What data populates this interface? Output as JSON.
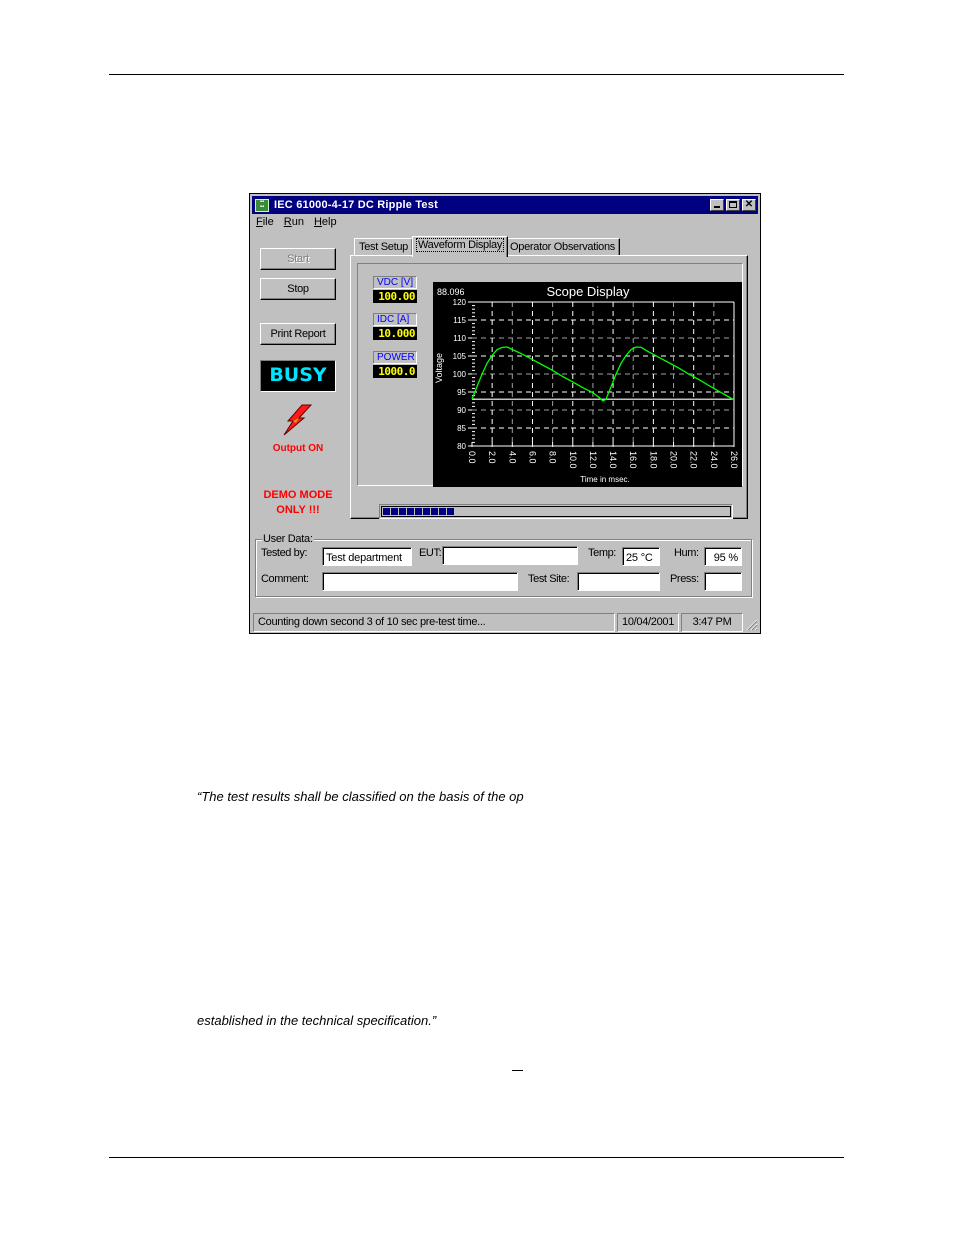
{
  "document": {
    "quote_line_1": "“The test results shall be classified on the basis of the op",
    "quote_line_2": "established in the technical specification.”"
  },
  "window": {
    "title": "IEC 61000-4-17 DC Ripple Test",
    "app_icon": "app-icon",
    "controls": {
      "minimize": "_",
      "maximize": "□",
      "close": "×"
    },
    "menu": [
      {
        "label": "File",
        "accel": "F",
        "rest": "ile"
      },
      {
        "label": "Run",
        "accel": "R",
        "rest": "un"
      },
      {
        "label": "Help",
        "accel": "H",
        "rest": "elp"
      }
    ]
  },
  "left_panel": {
    "start_label": "Start",
    "start_enabled": false,
    "stop_label": "Stop",
    "print_report_label": "Print Report",
    "busy_indicator": "BUSY",
    "output_status_icon": "lightning-bolt-icon",
    "output_status": "Output ON",
    "demo_notice_line1": "DEMO MODE",
    "demo_notice_line2": "ONLY !!!",
    "colors": {
      "busy_text": "#00e5ff",
      "warning_text": "#ff0000"
    }
  },
  "tabs": [
    {
      "label": "Test Setup",
      "active": false
    },
    {
      "label": "Waveform Display",
      "active": true
    },
    {
      "label": "Operator Observations",
      "active": false
    }
  ],
  "meters": [
    {
      "label": "VDC [V]",
      "value": "100.00"
    },
    {
      "label": "IDC [A]",
      "value": "10.000"
    },
    {
      "label": "POWER",
      "value": "1000.0"
    }
  ],
  "progress": {
    "fraction": 0.24,
    "segments_filled": 9
  },
  "chart_data": {
    "type": "line",
    "title": "Scope Display",
    "corner_readout": "88.096",
    "xlabel": "Time in msec.",
    "ylabel": "Voltage",
    "xlim": [
      0,
      26
    ],
    "ylim": [
      80,
      120
    ],
    "x_ticks": [
      "0.0",
      "2.0",
      "4.0",
      "6.0",
      "8.0",
      "10.0",
      "12.0",
      "14.0",
      "16.0",
      "18.0",
      "20.0",
      "22.0",
      "24.0",
      "26.0"
    ],
    "y_ticks": [
      "80",
      "85",
      "90",
      "95",
      "100",
      "105",
      "110",
      "115",
      "120"
    ],
    "grid": true,
    "reference_line": 93,
    "colors": {
      "trace": "#00ff00",
      "grid": "#ffffff",
      "background": "#000000"
    },
    "series": [
      {
        "name": "Voltage",
        "x": [
          0.0,
          0.5,
          1.0,
          1.5,
          2.0,
          2.5,
          3.0,
          3.5,
          4.0,
          5.0,
          6.0,
          7.0,
          8.0,
          9.0,
          10.0,
          11.0,
          12.0,
          12.6,
          13.0,
          13.3,
          13.8,
          14.3,
          14.8,
          15.3,
          15.8,
          16.3,
          16.8,
          17.5,
          18.5,
          19.5,
          20.5,
          21.5,
          22.5,
          23.5,
          24.5,
          25.5,
          26.0
        ],
        "y": [
          93.0,
          96.5,
          100.0,
          103.0,
          105.2,
          106.8,
          107.4,
          107.5,
          106.8,
          105.5,
          104.0,
          102.5,
          101.0,
          99.3,
          97.8,
          96.2,
          94.8,
          93.5,
          92.5,
          93.0,
          96.5,
          100.0,
          103.0,
          105.2,
          106.8,
          107.5,
          107.4,
          106.2,
          104.7,
          103.2,
          101.7,
          100.0,
          98.5,
          96.8,
          95.2,
          93.6,
          92.8
        ]
      }
    ]
  },
  "user_data": {
    "group_label": "User Data:",
    "tested_by_label": "Tested by:",
    "tested_by_value": "Test department",
    "eut_label": "EUT:",
    "eut_value": "",
    "temp_label": "Temp:",
    "temp_value": "25 °C",
    "hum_label": "Hum:",
    "hum_value": "95 %",
    "comment_label": "Comment:",
    "comment_value": "",
    "test_site_label": "Test Site:",
    "test_site_value": "",
    "press_label": "Press:",
    "press_value": ""
  },
  "status_bar": {
    "message": "Counting down second 3 of 10 sec pre-test time...",
    "date": "10/04/2001",
    "time": "3:47 PM"
  }
}
